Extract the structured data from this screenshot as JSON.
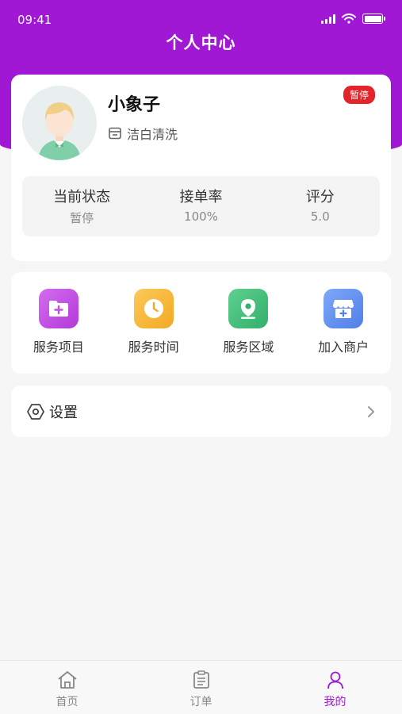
{
  "status_bar": {
    "time": "09:41"
  },
  "header": {
    "title": "个人中心"
  },
  "profile": {
    "name": "小象子",
    "shop_name": "洁白清洗",
    "status_badge": "暂停",
    "stats": [
      {
        "label": "当前状态",
        "value": "暂停"
      },
      {
        "label": "接单率",
        "value": "100%"
      },
      {
        "label": "评分",
        "value": "5.0"
      }
    ]
  },
  "menu": {
    "items": [
      {
        "label": "服务项目",
        "icon": "folder-plus-icon",
        "color": "#c34fe3"
      },
      {
        "label": "服务时间",
        "icon": "clock-icon",
        "color": "#f6b53c"
      },
      {
        "label": "服务区域",
        "icon": "location-pin-icon",
        "color": "#3fbf78"
      },
      {
        "label": "加入商户",
        "icon": "store-plus-icon",
        "color": "#5f8ff0"
      }
    ]
  },
  "settings": {
    "label": "设置"
  },
  "tabbar": {
    "items": [
      {
        "label": "首页",
        "icon": "home-icon"
      },
      {
        "label": "订单",
        "icon": "orders-icon"
      },
      {
        "label": "我的",
        "icon": "user-icon"
      }
    ],
    "active": "我的",
    "active_color": "#a018d3"
  },
  "colors": {
    "header": "#a018d3",
    "badge": "#e3242b"
  }
}
